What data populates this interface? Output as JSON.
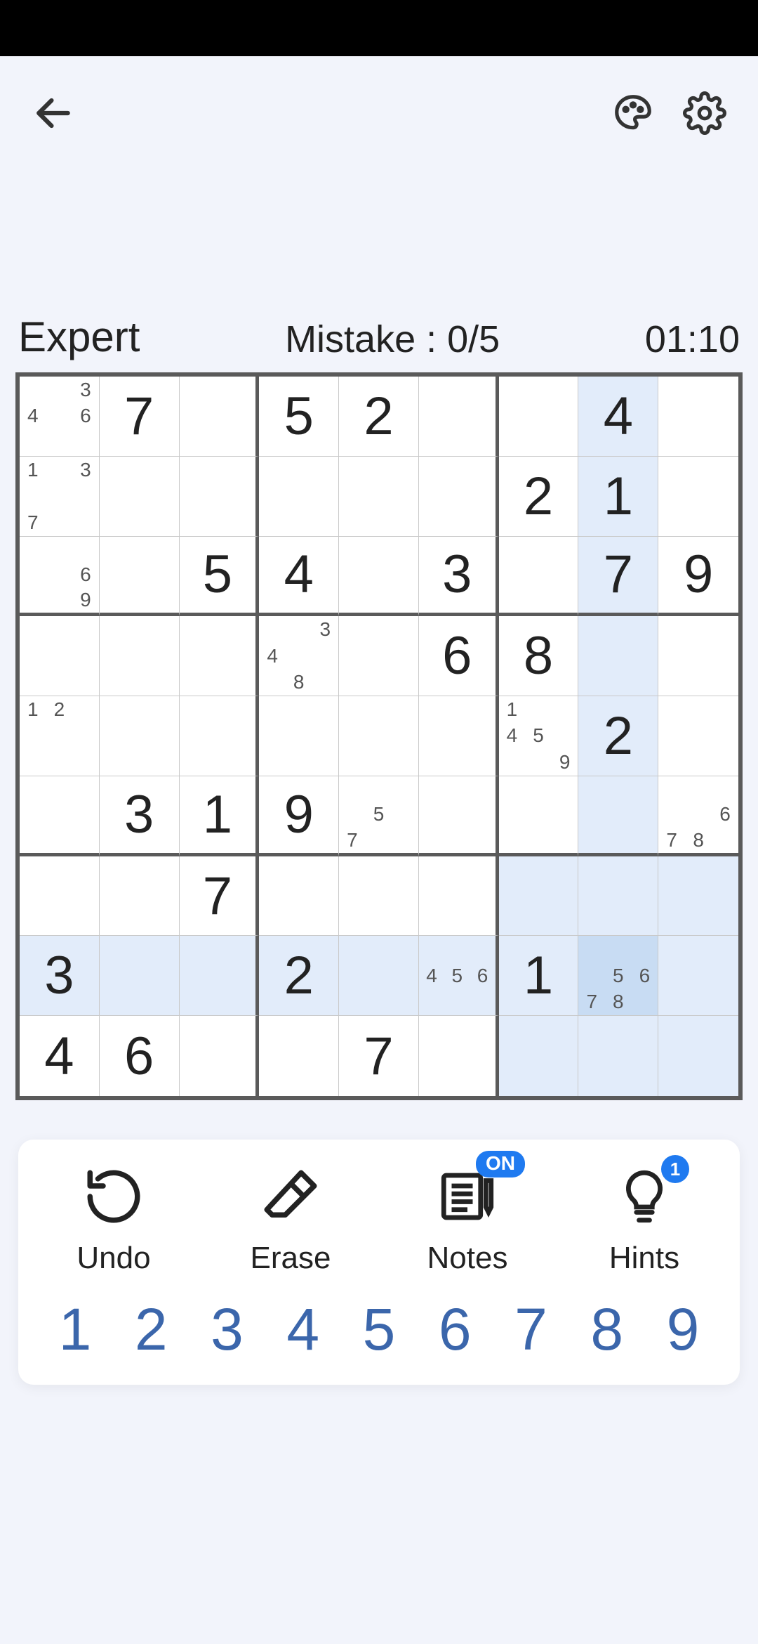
{
  "info": {
    "difficulty": "Expert",
    "mistakes_label": "Mistake : 0/5",
    "timer": "01:10"
  },
  "notes_badge": "ON",
  "hints_badge": "1",
  "toolbar": {
    "undo": "Undo",
    "erase": "Erase",
    "notes": "Notes",
    "hints": "Hints"
  },
  "numpad": [
    "1",
    "2",
    "3",
    "4",
    "5",
    "6",
    "7",
    "8",
    "9"
  ],
  "selected": {
    "row": 7,
    "col": 7
  },
  "board": [
    [
      {
        "n": [
          "",
          "",
          "3",
          "4",
          "",
          "6",
          "",
          "",
          ""
        ]
      },
      {
        "v": "7"
      },
      {},
      {
        "v": "5"
      },
      {
        "v": "2"
      },
      {},
      {},
      {
        "v": "4"
      },
      {}
    ],
    [
      {
        "n": [
          "1",
          "",
          "3",
          "",
          "",
          "",
          "7",
          "",
          ""
        ]
      },
      {},
      {},
      {},
      {},
      {},
      {
        "v": "2"
      },
      {
        "v": "1"
      },
      {}
    ],
    [
      {
        "n": [
          "",
          "",
          "",
          "",
          "",
          "6",
          "",
          "",
          "9"
        ]
      },
      {},
      {
        "v": "5"
      },
      {
        "v": "4"
      },
      {},
      {
        "v": "3"
      },
      {},
      {
        "v": "7"
      },
      {
        "v": "9"
      }
    ],
    [
      {},
      {},
      {},
      {
        "n": [
          "",
          "",
          "3",
          "4",
          "",
          "",
          "",
          "8",
          ""
        ]
      },
      {},
      {
        "v": "6"
      },
      {
        "v": "8"
      },
      {},
      {}
    ],
    [
      {
        "n": [
          "1",
          "2",
          "",
          "",
          "",
          "",
          "",
          "",
          ""
        ]
      },
      {},
      {},
      {},
      {},
      {},
      {
        "n": [
          "1",
          "",
          "",
          "4",
          "5",
          "",
          "",
          "",
          "9"
        ]
      },
      {
        "v": "2"
      },
      {}
    ],
    [
      {},
      {
        "v": "3"
      },
      {
        "v": "1"
      },
      {
        "v": "9"
      },
      {
        "n": [
          "",
          "",
          "",
          "",
          "5",
          "",
          "7",
          "",
          ""
        ]
      },
      {},
      {},
      {},
      {
        "n": [
          "",
          "",
          "",
          "",
          "",
          "6",
          "7",
          "8",
          ""
        ]
      }
    ],
    [
      {},
      {},
      {
        "v": "7"
      },
      {},
      {},
      {},
      {},
      {},
      {}
    ],
    [
      {
        "v": "3"
      },
      {},
      {},
      {
        "v": "2"
      },
      {},
      {
        "n": [
          "",
          "",
          "",
          "4",
          "5",
          "6",
          "",
          "",
          ""
        ]
      },
      {
        "v": "1"
      },
      {
        "n": [
          "",
          "",
          "",
          "",
          "5",
          "6",
          "7",
          "8",
          ""
        ]
      },
      {}
    ],
    [
      {
        "v": "4"
      },
      {
        "v": "6"
      },
      {},
      {},
      {
        "v": "7"
      },
      {},
      {},
      {},
      {}
    ]
  ]
}
